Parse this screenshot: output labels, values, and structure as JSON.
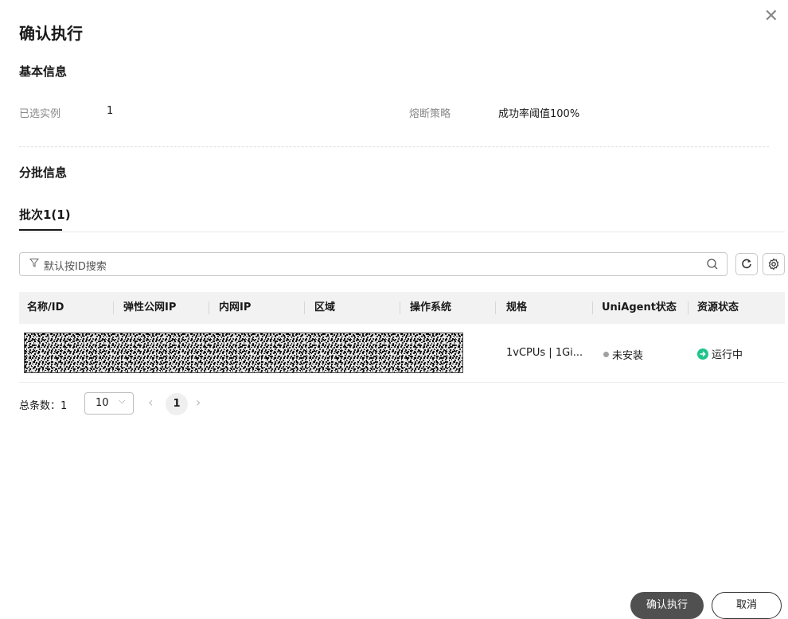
{
  "dialog": {
    "title": "确认执行",
    "close_icon": "close-icon"
  },
  "basic_info": {
    "section_title": "基本信息",
    "selected_instances_label": "已选实例",
    "selected_instances_value": "1",
    "circuit_breaker_label": "熔断策略",
    "circuit_breaker_value": "成功率阈值100%"
  },
  "batch_info": {
    "section_title": "分批信息",
    "tabs": [
      {
        "label": "批次1(1)",
        "active": true
      }
    ]
  },
  "search": {
    "placeholder": "默认按ID搜索",
    "filter_icon": "filter-icon",
    "search_icon": "search-icon",
    "refresh_icon": "refresh-icon",
    "settings_icon": "gear-icon"
  },
  "table": {
    "columns": [
      "名称/ID",
      "弹性公网IP",
      "内网IP",
      "区域",
      "操作系统",
      "规格",
      "UniAgent状态",
      "资源状态"
    ],
    "rows": [
      {
        "spec": "1vCPUs | 1Gi...",
        "uniagent_status": "未安装",
        "uniagent_status_color": "#a0a0a0",
        "resource_status": "运行中",
        "resource_status_color": "#20c38a"
      }
    ]
  },
  "pagination": {
    "total_label": "总条数：",
    "total_value": "1",
    "page_size": "10",
    "current_page": "1"
  },
  "footer": {
    "confirm_label": "确认执行",
    "cancel_label": "取消"
  },
  "colors": {
    "primary_button": "#505050",
    "running": "#20c38a"
  }
}
